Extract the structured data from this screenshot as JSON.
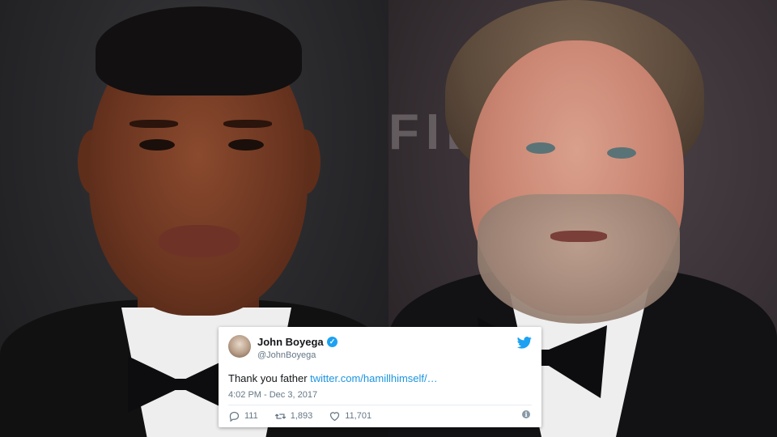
{
  "photos": {
    "left": {
      "subject": "man-in-tuxedo-left"
    },
    "right": {
      "subject": "man-in-tuxedo-right",
      "backdrop_text": "FIL"
    }
  },
  "tweet": {
    "author_name": "John Boyega",
    "handle": "@JohnBoyega",
    "verified": true,
    "text_prefix": "Thank you father ",
    "link_text": "twitter.com/hamillhimself/…",
    "timestamp": "4:02 PM - Dec 3, 2017",
    "replies": "111",
    "retweets": "1,893",
    "likes": "11,701",
    "icons": {
      "brand": "twitter-bird-icon",
      "verified": "verified-badge-icon",
      "reply": "reply-icon",
      "retweet": "retweet-icon",
      "like": "heart-icon",
      "info": "info-icon"
    },
    "colors": {
      "accent": "#1da1f2",
      "link": "#1b95e0",
      "muted": "#657786",
      "text": "#14171a"
    }
  }
}
